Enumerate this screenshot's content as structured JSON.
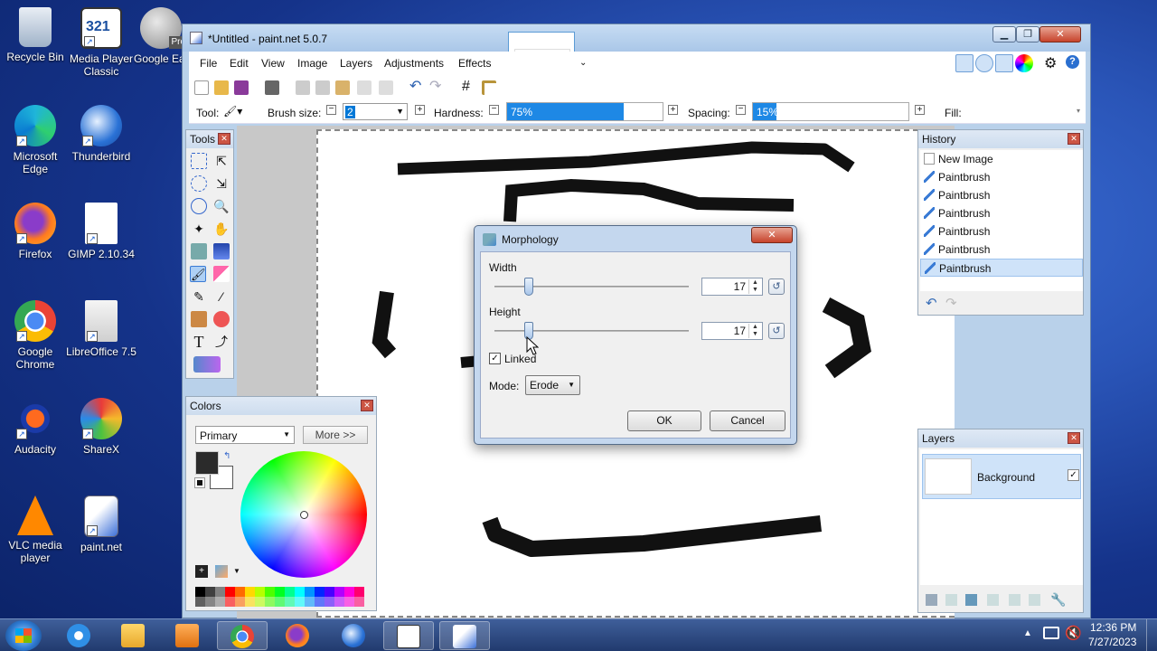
{
  "desktop": {
    "icons": [
      {
        "label": "Recycle Bin"
      },
      {
        "label": "Media Player Classic"
      },
      {
        "label": "Google Earth Pro",
        "badge": "Pro"
      },
      {
        "label": "Microsoft Edge"
      },
      {
        "label": "Thunderbird"
      },
      {
        "label": "Firefox"
      },
      {
        "label": "GIMP 2.10.34"
      },
      {
        "label": "Google Chrome"
      },
      {
        "label": "LibreOffice 7.5"
      },
      {
        "label": "Audacity"
      },
      {
        "label": "ShareX"
      },
      {
        "label": "VLC media player"
      },
      {
        "label": "paint.net"
      }
    ]
  },
  "window": {
    "title": "*Untitled - paint.net 5.0.7",
    "menu": [
      "File",
      "Edit",
      "View",
      "Image",
      "Layers",
      "Adjustments",
      "Effects"
    ],
    "toolbar": {
      "tool_label": "Tool:",
      "brush_size_label": "Brush size:",
      "brush_size_value": "2",
      "hardness_label": "Hardness:",
      "hardness_value": "75%",
      "hardness_fraction": 0.75,
      "spacing_label": "Spacing:",
      "spacing_value": "15%",
      "spacing_fraction": 0.15,
      "fill_label": "Fill:"
    }
  },
  "tools_panel": {
    "title": "Tools"
  },
  "colors_panel": {
    "title": "Colors",
    "select_value": "Primary",
    "more_button": "More >>",
    "primary_color": "#2b2b2b",
    "secondary_color": "#ffffff"
  },
  "history_panel": {
    "title": "History",
    "items": [
      "New Image",
      "Paintbrush",
      "Paintbrush",
      "Paintbrush",
      "Paintbrush",
      "Paintbrush",
      "Paintbrush"
    ],
    "selected_index": 6
  },
  "layers_panel": {
    "title": "Layers",
    "layer_name": "Background",
    "visible": true
  },
  "dialog": {
    "title": "Morphology",
    "width_label": "Width",
    "width_value": "17",
    "height_label": "Height",
    "height_value": "17",
    "linked_label": "Linked",
    "linked_checked": true,
    "mode_label": "Mode:",
    "mode_value": "Erode",
    "ok": "OK",
    "cancel": "Cancel"
  },
  "taskbar": {
    "time": "12:36 PM",
    "date": "7/27/2023"
  },
  "palette": [
    "#000000",
    "#404040",
    "#808080",
    "#ff0000",
    "#ff6a00",
    "#ffd800",
    "#b6ff00",
    "#4cff00",
    "#00ff21",
    "#00ff90",
    "#00ffff",
    "#0094ff",
    "#0026ff",
    "#4800ff",
    "#b200ff",
    "#ff00dc",
    "#ff006e"
  ]
}
